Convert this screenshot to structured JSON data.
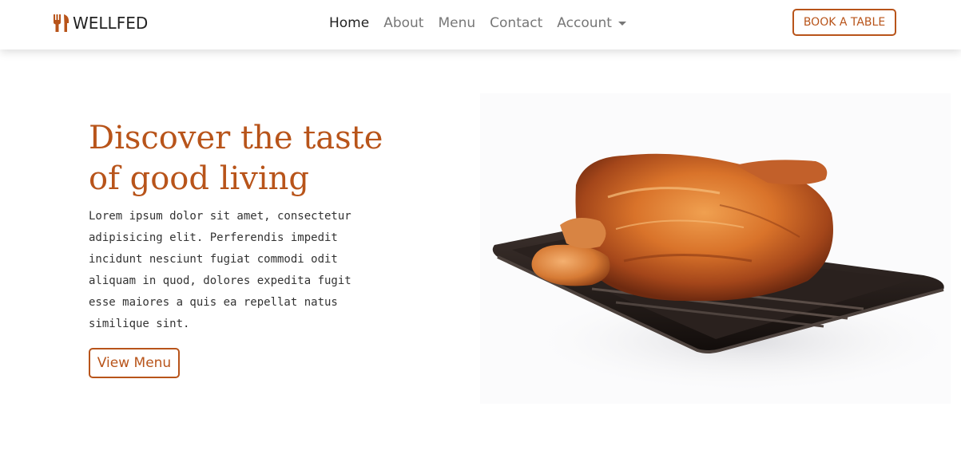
{
  "brand": {
    "name": "WELLFED",
    "icon": "fork-knife-icon"
  },
  "nav": {
    "links": [
      "Home",
      "About",
      "Menu",
      "Contact"
    ],
    "active": "Home",
    "account": "Account"
  },
  "cta": {
    "book_label": "BOOK A TABLE"
  },
  "hero": {
    "title_line1": "Discover the taste",
    "title_line2": "of good living",
    "text_lines": [
      "Lorem ipsum dolor sit amet, consectetur",
      "adipisicing elit. Perferendis impedit",
      "incidunt nesciunt fugiat commodi odit",
      "aliquam in quod, dolores expedita fugit",
      "esse maiores a quis ea repellat natus",
      "similique sint."
    ],
    "button_label": "View Menu",
    "image": "roast-chicken-on-tray"
  },
  "colors": {
    "accent": "#b8541a",
    "text": "#333333",
    "nav_text": "#777777",
    "nav_active": "#222222"
  }
}
